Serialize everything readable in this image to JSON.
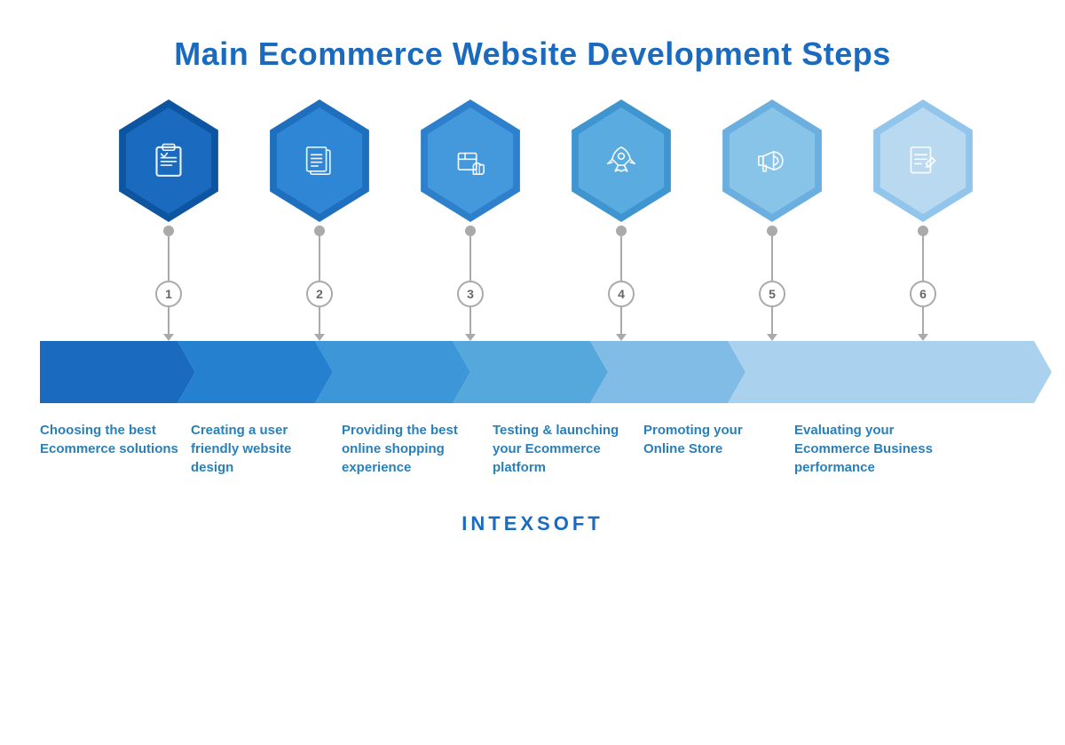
{
  "title": "Main Ecommerce Website Development Steps",
  "steps": [
    {
      "number": "1",
      "color_border": "#0d55a0",
      "color_bg": "#1a6bbf",
      "banner_color": "#1a6bbf",
      "description": "Choosing the best Ecommerce solutions",
      "icon": "clipboard"
    },
    {
      "number": "2",
      "color_border": "#1e6fbe",
      "color_bg": "#2e86d4",
      "banner_color": "#2580cf",
      "description": "Creating a user friendly website design",
      "icon": "documents"
    },
    {
      "number": "3",
      "color_border": "#2e80cc",
      "color_bg": "#4499dd",
      "banner_color": "#3d96d8",
      "description": "Providing the best online shopping experience",
      "icon": "box"
    },
    {
      "number": "4",
      "color_border": "#3f95d0",
      "color_bg": "#5aabdf",
      "banner_color": "#55a8dc",
      "description": "Testing & launching your Ecommerce platform",
      "icon": "rocket"
    },
    {
      "number": "5",
      "color_border": "#6aafe0",
      "color_bg": "#88c3e8",
      "banner_color": "#80bce5",
      "description": "Promoting your Online Store",
      "icon": "megaphone"
    },
    {
      "number": "6",
      "color_border": "#92c5ec",
      "color_bg": "#b8d9f0",
      "banner_color": "#aad1ed",
      "description": "Evaluating your Ecommerce Business performance",
      "icon": "document-edit"
    }
  ],
  "brand": "INTEXSOFT"
}
